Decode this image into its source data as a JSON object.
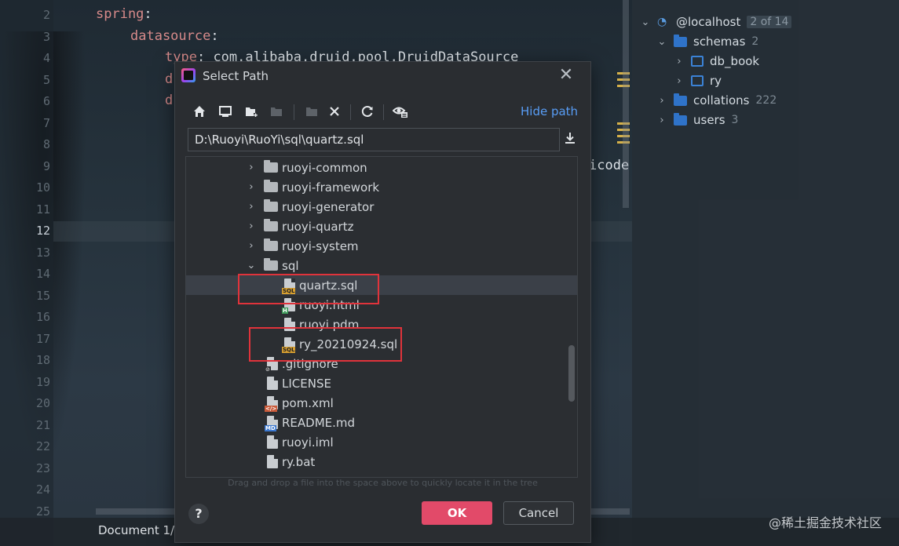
{
  "editor": {
    "line_numbers": [
      "2",
      "3",
      "4",
      "5",
      "6",
      "7",
      "8",
      "9",
      "10",
      "11",
      "12",
      "13",
      "14",
      "15",
      "16",
      "17",
      "18",
      "19",
      "20",
      "21",
      "22",
      "23",
      "24",
      "25"
    ],
    "active_line": "12",
    "code": {
      "spring_key": "spring",
      "datasource_key": "datasource",
      "type_key": "type",
      "type_value": "com.alibaba.druid.pool.DruidDataSource",
      "line5_fragment": "d",
      "line6_fragment": "d",
      "line9_fragment": "icode"
    }
  },
  "status": {
    "document": "Document 1/",
    "watermark": "@稀土掘金技术社区"
  },
  "db_panel": {
    "host": {
      "label": "@localhost",
      "badge": "2 of 14"
    },
    "schemas": {
      "label": "schemas",
      "count": "2"
    },
    "schema_items": [
      "db_book",
      "ry"
    ],
    "collations": {
      "label": "collations",
      "count": "222"
    },
    "users": {
      "label": "users",
      "count": "3"
    }
  },
  "dialog": {
    "title": "Select Path",
    "hide_path": "Hide path",
    "path_value": "D:\\Ruoyi\\RuoYi\\sql\\quartz.sql",
    "toolbar_icons": [
      "home-icon",
      "desktop-icon",
      "new-folder-icon",
      "project-icon",
      "module-icon",
      "delete-icon",
      "refresh-icon",
      "show-hidden-icon"
    ],
    "tree": {
      "folders": [
        "ruoyi-common",
        "ruoyi-framework",
        "ruoyi-generator",
        "ruoyi-quartz",
        "ruoyi-system"
      ],
      "sql_folder": "sql",
      "sql_files": [
        {
          "name": "quartz.sql",
          "tag": "SQL"
        },
        {
          "name": "ruoyi.html",
          "tag": "H"
        },
        {
          "name": "ruoyi.pdm",
          "tag": ""
        },
        {
          "name": "ry_20210924.sql",
          "tag": "SQL"
        }
      ],
      "root_files": [
        {
          "name": ".gitignore",
          "tag": "⊘"
        },
        {
          "name": "LICENSE",
          "tag": ""
        },
        {
          "name": "pom.xml",
          "tag": "</>"
        },
        {
          "name": "README.md",
          "tag": "MD"
        },
        {
          "name": "ruoyi.iml",
          "tag": ""
        },
        {
          "name": "ry.bat",
          "tag": ""
        }
      ]
    },
    "hint": "Drag and drop a file into the space above to quickly locate it in the tree",
    "help": "?",
    "ok": "OK",
    "cancel": "Cancel"
  },
  "colors": {
    "accent_link": "#589df6",
    "ok_button": "#e24a69",
    "highlight_box": "#e0333b"
  }
}
